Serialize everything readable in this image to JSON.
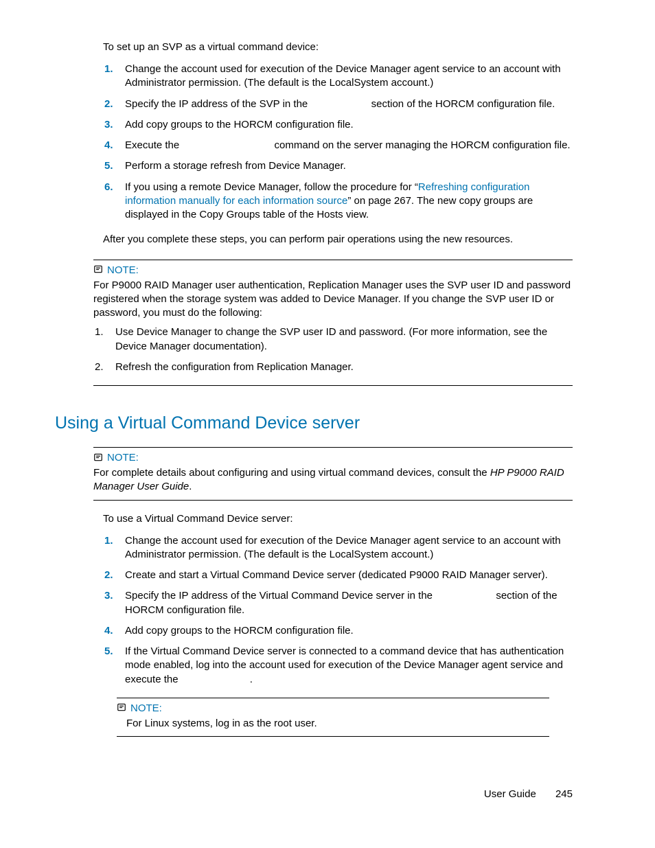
{
  "intro1": "To set up an SVP as a virtual command device:",
  "list1": {
    "i1": "Change the account used for execution of the Device Manager agent service to an account with Administrator permission. (The default is the LocalSystem account.)",
    "i2a": "Specify the IP address of the SVP in the ",
    "i2b": " section of the HORCM configuration file.",
    "i3": "Add copy groups to the HORCM configuration file.",
    "i4a": "Execute the ",
    "i4b": " command on the server managing the HORCM configuration file.",
    "i5": "Perform a storage refresh from Device Manager.",
    "i6a": "If you using a remote Device Manager, follow the procedure for “",
    "i6link": "Refreshing configuration information manually for each information source",
    "i6b": "” on page 267. The new copy groups are displayed in the Copy Groups table of the Hosts view."
  },
  "after1": "After you complete these steps, you can perform pair operations using the new resources.",
  "note1": {
    "label": "NOTE:",
    "body": "For P9000 RAID Manager user authentication, Replication Manager uses the SVP user ID and password registered when the storage system was added to Device Manager. If you change the SVP user ID or password, you must do the following:",
    "l1": "Use Device Manager to change the SVP user ID and password. (For more information, see the Device Manager documentation).",
    "l2": "Refresh the configuration from Replication Manager."
  },
  "heading1": "Using a Virtual Command Device server",
  "note2": {
    "label": "NOTE:",
    "body_a": "For complete details about configuring and using virtual command devices, consult the ",
    "body_i": "HP P9000 RAID Manager User Guide",
    "body_b": "."
  },
  "intro2": "To use a Virtual Command Device server:",
  "list2": {
    "i1": "Change the account used for execution of the Device Manager agent service to an account with Administrator permission. (The default is the LocalSystem account.)",
    "i2": "Create and start a Virtual Command Device server (dedicated P9000 RAID Manager server).",
    "i3a": "Specify the IP address of the Virtual Command Device server in the ",
    "i3b": " section of the HORCM configuration file.",
    "i4": "Add copy groups to the HORCM configuration file.",
    "i5a": "If the Virtual Command Device server is connected to a command device that has authentication mode enabled, log into the account used for execution of the Device Manager agent service and execute the ",
    "i5b": "."
  },
  "note3": {
    "label": "NOTE:",
    "body": "For Linux systems, log in as the root user."
  },
  "footer": {
    "title": "User Guide",
    "page": "245"
  }
}
